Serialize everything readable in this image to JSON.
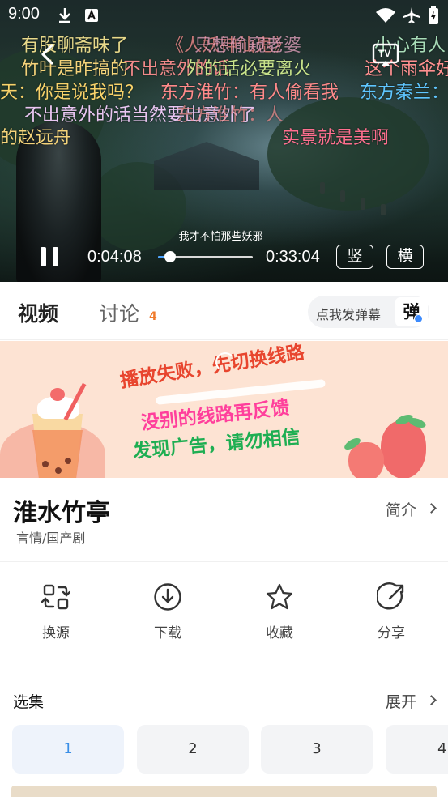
{
  "status_bar": {
    "time": "9:00"
  },
  "player": {
    "subtitle": "我才不怕那些妖邪",
    "current_time": "0:04:08",
    "total_time": "0:33:04",
    "progress": 0.125,
    "vertical_label": "竖",
    "horizontal_label": "横",
    "tv_label": "TV",
    "danmaku": [
      {
        "text": "有股聊斋味了",
        "color": "#e8d98a"
      },
      {
        "text": "《人妖神仙鬼》",
        "color": "#f28a8a"
      },
      {
        "text": "只想偷窥老婆",
        "color": "#e6a3c0"
      },
      {
        "text": "小心有人",
        "color": "#a8dcb8"
      },
      {
        "text": "竹叶是昨搞的",
        "color": "#f4d37a"
      },
      {
        "text": "不出意外的话",
        "color": "#f28a8a"
      },
      {
        "text": "外的话必要离火",
        "color": "#c8e38a"
      },
      {
        "text": "这个雨伞好",
        "color": "#ff9090"
      },
      {
        "text": "天：你是说我吗？",
        "color": "#f8d26a"
      },
      {
        "text": "东方淮竹：有人偷看我",
        "color": "#ff8a8a"
      },
      {
        "text": "东方秦兰：",
        "color": "#5fc6ff"
      },
      {
        "text": "不出意外的话当然要出意外了",
        "color": "#e9c6f2"
      },
      {
        "text": "东方淮竹：人",
        "color": "#f28a8a"
      },
      {
        "text": "的赵远舟",
        "color": "#f4d37a"
      },
      {
        "text": "实景就是美啊",
        "color": "#ff6f8f"
      }
    ]
  },
  "tabs": {
    "video": "视频",
    "discuss": "讨论",
    "discuss_count": "4",
    "send_danmaku": "点我发弹幕",
    "danmaku_badge": "弹"
  },
  "banner": {
    "line1": "播放失败，先切换线路",
    "line2": "没别的线路再反馈",
    "line3": "发现广告，请勿相信",
    "color1": "#e8452e",
    "color2": "#ff3f9c",
    "color3": "#1eae52"
  },
  "show": {
    "title": "淮水竹亭",
    "genre": "言情/国产剧",
    "intro_label": "简介"
  },
  "actions": {
    "switch_source": "换源",
    "download": "下载",
    "favorite": "收藏",
    "share": "分享"
  },
  "episodes": {
    "header": "选集",
    "expand": "展开",
    "list": [
      "1",
      "2",
      "3",
      "4"
    ],
    "active": "1"
  }
}
